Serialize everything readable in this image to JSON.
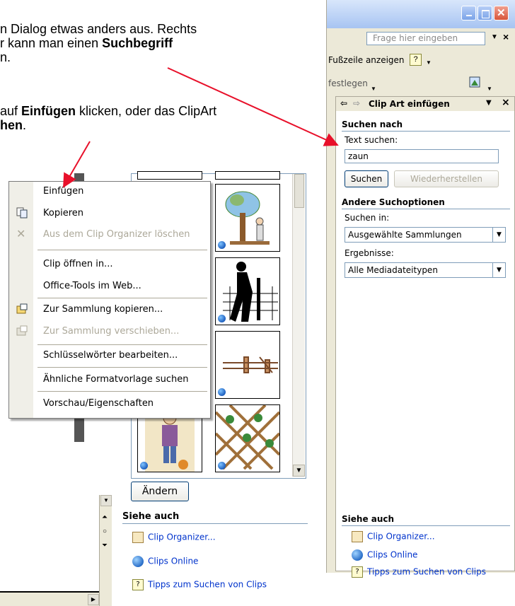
{
  "tutorial": {
    "line1": "n Dialog etwas anders aus. Rechts",
    "line2_pre": "r kann man einen ",
    "line2_bold": "Suchbegriff",
    "line3": "n.",
    "line4_pre": "auf ",
    "line4_bold": "Einfügen",
    "line4_post": " klicken, oder das ClipArt",
    "line5_bold": "hen",
    "line5_post": "."
  },
  "window": {
    "ask_placeholder": "Frage hier eingeben",
    "toolbar1_label": "Fußzeile anzeigen",
    "toolbar2_label": "festlegen"
  },
  "taskpane": {
    "title": "Clip Art einfügen",
    "search_section": "Suchen nach",
    "text_search_label": "Text suchen:",
    "search_value": "zaun",
    "search_button": "Suchen",
    "restore_button": "Wiederherstellen",
    "other_options": "Andere Suchoptionen",
    "search_in_label": "Suchen in:",
    "search_in_value": "Ausgewählte Sammlungen",
    "results_label": "Ergebnisse:",
    "results_value": "Alle Mediadateitypen",
    "see_also": "Siehe auch",
    "link_organizer": "Clip Organizer...",
    "link_online": "Clips Online",
    "link_tips": "Tipps zum Suchen von Clips"
  },
  "context_menu": {
    "items": [
      {
        "label": "Einfügen",
        "disabled": false
      },
      {
        "label": "Kopieren",
        "disabled": false
      },
      {
        "label": "Aus dem Clip Organizer löschen",
        "disabled": true
      },
      {
        "label": "Clip öffnen in...",
        "disabled": false
      },
      {
        "label": "Office-Tools im Web...",
        "disabled": false
      },
      {
        "label": "Zur Sammlung kopieren...",
        "disabled": false
      },
      {
        "label": "Zur Sammlung verschieben...",
        "disabled": true
      },
      {
        "label": "Schlüsselwörter bearbeiten...",
        "disabled": false
      },
      {
        "label": "Ähnliche Formatvorlage suchen",
        "disabled": false
      },
      {
        "label": "Vorschau/Eigenschaften",
        "disabled": false
      }
    ]
  },
  "clip_panel": {
    "change_button": "Ändern",
    "see_also": "Siehe auch",
    "link_organizer": "Clip Organizer...",
    "link_online": "Clips Online",
    "link_tips": "Tipps zum Suchen von Clips"
  },
  "colors": {
    "arrow": "#e8102a",
    "link": "#0033cc",
    "pane_bg": "#ece9d8"
  }
}
